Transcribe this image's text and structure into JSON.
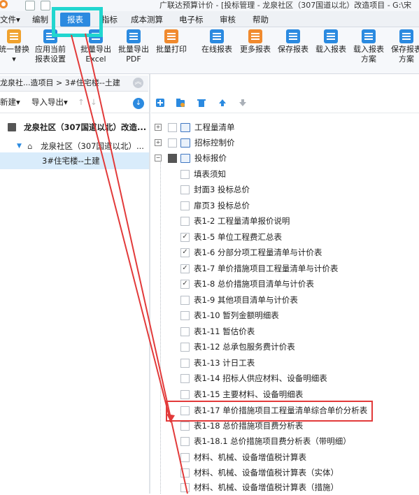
{
  "app": {
    "title": "广联达预算计价 - [投标管理 - 龙泉社区（307国道以北）改造项目 - G:\\宋"
  },
  "menu": {
    "items": [
      "文件▾",
      "编制",
      "报表",
      "指标",
      "成本测算",
      "电子标",
      "审核",
      "帮助"
    ],
    "active": "报表"
  },
  "toolbar": {
    "buttons": [
      {
        "label": "统一替换",
        "label2": "▾",
        "icon": "replace-icon",
        "color": "#f0a22e"
      },
      {
        "label": "应用当前",
        "label2": "报表设置",
        "icon": "apply-settings-icon",
        "color": "#2b8ae0"
      },
      {
        "label": "批量导出",
        "label2": "Excel",
        "icon": "excel-export-icon",
        "color": "#2b8ae0"
      },
      {
        "label": "批量导出",
        "label2": "PDF",
        "icon": "pdf-export-icon",
        "color": "#2b8ae0"
      },
      {
        "label": "批量打印",
        "label2": "",
        "icon": "print-icon",
        "color": "#f08a2e"
      },
      {
        "label": "在线报表",
        "label2": "",
        "icon": "online-report-icon",
        "color": "#2b8ae0"
      },
      {
        "label": "更多报表",
        "label2": "",
        "icon": "more-reports-icon",
        "color": "#f08a2e"
      },
      {
        "label": "保存报表",
        "label2": "",
        "icon": "save-report-icon",
        "color": "#2b8ae0"
      },
      {
        "label": "载入报表",
        "label2": "",
        "icon": "load-report-icon",
        "color": "#2b8ae0"
      },
      {
        "label": "载入报表",
        "label2": "方案",
        "icon": "load-scheme-icon",
        "color": "#2b8ae0"
      },
      {
        "label": "保存报表",
        "label2": "方案",
        "icon": "save-scheme-icon",
        "color": "#2b8ae0"
      }
    ]
  },
  "breadcrumb": {
    "text": "龙泉社...造项目 > 3#住宅楼--土建"
  },
  "left_toolbar": {
    "new": "新建▾",
    "import_export": "导入导出▾",
    "up": "↑",
    "down": "↓"
  },
  "left_tree": {
    "root": "龙泉社区（307国道以北）改造...",
    "node": "龙泉社区（307国道以北）...",
    "selected": "3#住宅楼--土建"
  },
  "right_tree": [
    {
      "label": "工程量清单",
      "expander": "+",
      "check": "",
      "folder": true
    },
    {
      "label": "招标控制价",
      "expander": "+",
      "check": "",
      "folder": true
    },
    {
      "label": "投标报价",
      "expander": "−",
      "check": "partial",
      "folder": true
    },
    {
      "label": "填表须知",
      "check": ""
    },
    {
      "label": "封面3 投标总价",
      "check": ""
    },
    {
      "label": "扉页3 投标总价",
      "check": ""
    },
    {
      "label": "表1-2 工程量清单报价说明",
      "check": ""
    },
    {
      "label": "表1-5 单位工程费汇总表",
      "check": "✓"
    },
    {
      "label": "表1-6 分部分项工程量清单与计价表",
      "check": "✓"
    },
    {
      "label": "表1-7 单价措施项目工程量清单与计价表",
      "check": "✓"
    },
    {
      "label": "表1-8 总价措施项目清单与计价表",
      "check": "✓"
    },
    {
      "label": "表1-9 其他项目清单与计价表",
      "check": ""
    },
    {
      "label": "表1-10 暂列金额明细表",
      "check": ""
    },
    {
      "label": "表1-11 暂估价表",
      "check": ""
    },
    {
      "label": "表1-12 总承包服务费计价表",
      "check": ""
    },
    {
      "label": "表1-13 计日工表",
      "check": ""
    },
    {
      "label": "表1-14 招标人供应材料、设备明细表",
      "check": ""
    },
    {
      "label": "表1-15 主要材料、设备明细表",
      "check": ""
    },
    {
      "label": "表1-17 单价措施项目工程量清单综合单价分析表",
      "check": ""
    },
    {
      "label": "表1-18 总价措施项目费分析表",
      "check": ""
    },
    {
      "label": "表1-18.1 总价措施项目费分析表（带明细）",
      "check": ""
    },
    {
      "label": "材料、机械、设备增值税计算表",
      "check": ""
    },
    {
      "label": "材料、机械、设备增值税计算表（实体）",
      "check": ""
    },
    {
      "label": "材料、机械、设备增值税计算表（措施）",
      "check": ""
    }
  ],
  "colors": {
    "accent": "#2b8ae0",
    "highlight_box": "#21d6cf",
    "annotation_red": "#e23a3a"
  }
}
